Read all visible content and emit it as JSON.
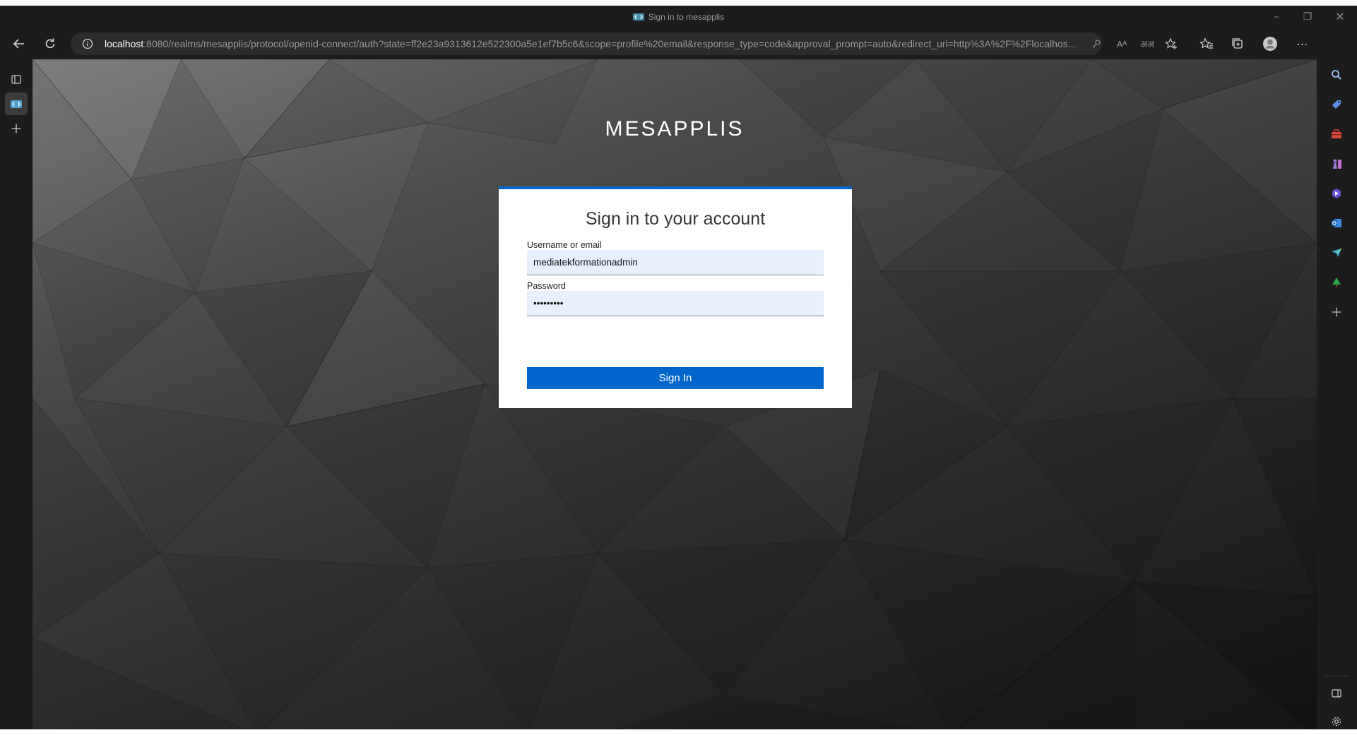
{
  "browser": {
    "tab_title": "Sign in to mesapplis",
    "url_host": "localhost",
    "url_rest": ":8080/realms/mesapplis/protocol/openid-connect/auth?state=ff2e23a9313612e522300a5e1ef7b5c6&scope=profile%20email&response_type=code&approval_prompt=auto&redirect_uri=http%3A%2F%2Flocalhos...",
    "read_aloud_label": "Aᴬ",
    "translate_label": "अअ"
  },
  "page": {
    "brand": "MESAPPLIS",
    "card_title": "Sign in to your account",
    "username_label": "Username or email",
    "username_value": "mediatekformationadmin",
    "password_label": "Password",
    "password_value": "•••••••••",
    "signin_label": "Sign In"
  },
  "colors": {
    "accent": "#0066cc",
    "input_bg": "#e8f0fe",
    "chrome_bg": "#1c1c1c"
  }
}
